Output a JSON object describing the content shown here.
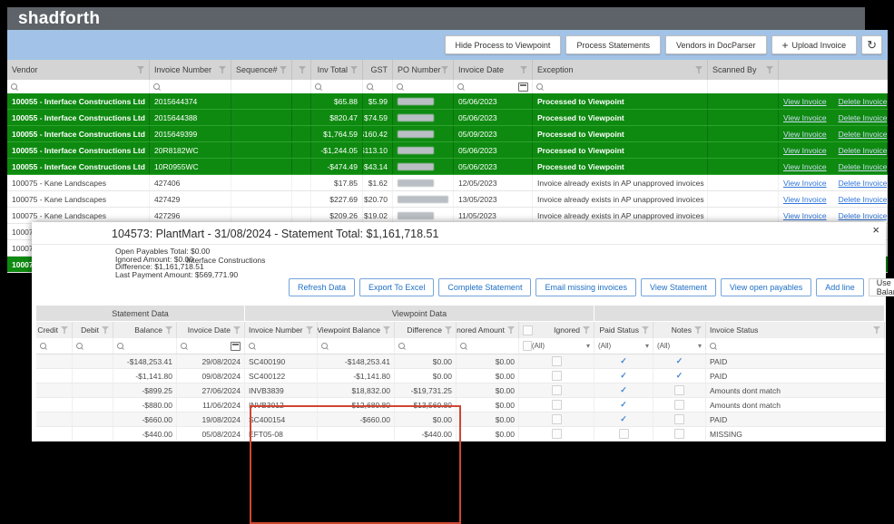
{
  "app": {
    "logo_text": "shadforth",
    "toolbar_buttons": [
      "Hide Process to Viewpoint",
      "Process Statements",
      "Vendors in DocParser"
    ],
    "upload_button": "Upload Invoice",
    "refresh_icon": "refresh-icon",
    "colors": {
      "header_bar": "#5d6368",
      "toolbar_blue": "#a2c3e7",
      "processed_green": "#0e8a10",
      "link_blue": "#2f74d9",
      "highlight_red": "#cf4632"
    }
  },
  "invoice_grid": {
    "columns": [
      {
        "label": "Vendor",
        "funnel": true,
        "filter": "search"
      },
      {
        "label": "Invoice Number",
        "funnel": true,
        "filter": "search"
      },
      {
        "label": "Sequence#",
        "funnel": true,
        "filter": "none"
      },
      {
        "label": "",
        "funnel": true,
        "filter": "none"
      },
      {
        "label": "Inv Total",
        "funnel": true,
        "align": "right",
        "filter": "search"
      },
      {
        "label": "GST",
        "funnel": false,
        "align": "right",
        "filter": "search"
      },
      {
        "label": "PO Number",
        "funnel": true,
        "filter": "search"
      },
      {
        "label": "Invoice Date",
        "funnel": true,
        "filter": "search cal"
      },
      {
        "label": "Exception",
        "funnel": true,
        "filter": "search"
      },
      {
        "label": "Scanned By",
        "funnel": true,
        "filter": "none"
      },
      {
        "label": "",
        "funnel": false,
        "filter": "none"
      }
    ],
    "action_labels": {
      "view": "View Invoice",
      "delete": "Delete Invoice"
    },
    "rows": [
      {
        "vendor": "100055 - Interface Constructions Ltd",
        "invoice_number": "2015644374",
        "sequence": "",
        "inv_total": "$65.88",
        "gst": "$5.99",
        "po_redacted": true,
        "po_blur": "sm",
        "invoice_date": "05/06/2023",
        "exception": "Processed to Viewpoint",
        "scanned_by": "",
        "highlighted": true
      },
      {
        "vendor": "100055 - Interface Constructions Ltd",
        "invoice_number": "2015644388",
        "sequence": "",
        "inv_total": "$820.47",
        "gst": "$74.59",
        "po_redacted": true,
        "po_blur": "sm",
        "invoice_date": "05/06/2023",
        "exception": "Processed to Viewpoint",
        "scanned_by": "",
        "highlighted": true
      },
      {
        "vendor": "100055 - Interface Constructions Ltd",
        "invoice_number": "2015649399",
        "sequence": "",
        "inv_total": "$1,764.59",
        "gst": "$160.42",
        "po_redacted": true,
        "po_blur": "sm",
        "invoice_date": "05/09/2023",
        "exception": "Processed to Viewpoint",
        "scanned_by": "",
        "highlighted": true
      },
      {
        "vendor": "100055 - Interface Constructions Ltd",
        "invoice_number": "20R8182WC",
        "sequence": "",
        "inv_total": "-$1,244.05",
        "gst": "-$113.10",
        "po_redacted": true,
        "po_blur": "sm",
        "invoice_date": "05/06/2023",
        "exception": "Processed to Viewpoint",
        "scanned_by": "",
        "highlighted": true
      },
      {
        "vendor": "100055 - Interface Constructions Ltd",
        "invoice_number": "10R0955WC",
        "sequence": "",
        "inv_total": "-$474.49",
        "gst": "-$43.14",
        "po_redacted": true,
        "po_blur": "sm",
        "invoice_date": "05/06/2023",
        "exception": "Processed to Viewpoint",
        "scanned_by": "",
        "highlighted": true
      },
      {
        "vendor": "100075 - Kane Landscapes",
        "invoice_number": "427406",
        "sequence": "",
        "inv_total": "$17.85",
        "gst": "$1.62",
        "po_redacted": true,
        "po_blur": "sm",
        "invoice_date": "12/05/2023",
        "exception": "Invoice already exists in AP unapproved invoices",
        "scanned_by": "",
        "highlighted": false
      },
      {
        "vendor": "100075 - Kane Landscapes",
        "invoice_number": "427429",
        "sequence": "",
        "inv_total": "$227.69",
        "gst": "$20.70",
        "po_redacted": true,
        "po_blur": "lg",
        "invoice_date": "13/05/2023",
        "exception": "Invoice already exists in AP unapproved invoices",
        "scanned_by": "",
        "highlighted": false
      },
      {
        "vendor": "100075 - Kane Landscapes",
        "invoice_number": "427296",
        "sequence": "",
        "inv_total": "$209.26",
        "gst": "$19.02",
        "po_redacted": true,
        "po_blur": "sm",
        "invoice_date": "11/05/2023",
        "exception": "Invoice already exists in AP unapproved invoices",
        "scanned_by": "",
        "highlighted": false
      }
    ],
    "partial_rows": [
      {
        "vendor": "100075 -",
        "highlighted": false
      },
      {
        "vendor": "100075 -",
        "highlighted": false
      },
      {
        "vendor": "100075 -",
        "highlighted": true
      }
    ]
  },
  "statement_panel": {
    "title": "104573: PlantMart - 31/08/2024 - Statement Total: $1,161,718.51",
    "close_glyph": "×",
    "summary_lines": [
      "Open Payables Total: $0.00",
      "Ignored Amount: $0.00",
      "Difference: $1,161,718.51",
      "Last Payment Amount: $569,771.90"
    ],
    "vendor_note": "Interface Constructions",
    "action_buttons": [
      "Refresh Data",
      "Export To Excel",
      "Complete Statement",
      "Email missing invoices",
      "View Statement",
      "View open payables",
      "Add line"
    ],
    "balance_dropdown_value": "Use Balance",
    "grid": {
      "group_headers": [
        "Statement Data",
        "Viewpoint Data",
        ""
      ],
      "filter_all_label": "(All)",
      "columns": [
        {
          "label": "Credit",
          "align": "right",
          "filter": "search"
        },
        {
          "label": "Debit",
          "align": "right",
          "filter": "search"
        },
        {
          "label": "Balance",
          "align": "right",
          "filter": "search"
        },
        {
          "label": "Invoice Date",
          "align": "right",
          "filter": "search cal"
        },
        {
          "label": "Invoice Number",
          "filter": "search"
        },
        {
          "label": "Viewpoint Balance",
          "align": "right",
          "filter": "search"
        },
        {
          "label": "Difference",
          "align": "right",
          "filter": "search"
        },
        {
          "label": "Ignored Amount",
          "align": "right",
          "filter": "search"
        },
        {
          "label": "Ignored",
          "align": "right",
          "filter": "all",
          "header_checkbox": true
        },
        {
          "label": "Paid Status",
          "align": "right",
          "filter": "all"
        },
        {
          "label": "Notes",
          "align": "right",
          "filter": "all"
        },
        {
          "label": "Invoice Status",
          "filter": "search"
        }
      ],
      "rows": [
        {
          "credit": "",
          "debit": "",
          "balance": "-$148,253.41",
          "invoice_date": "29/08/2024",
          "invoice_number": "SC400190",
          "viewpoint_balance": "-$148,253.41",
          "difference": "$0.00",
          "ignored_amount": "$0.00",
          "ignored": false,
          "paid_status": true,
          "notes": true,
          "invoice_status": "PAID"
        },
        {
          "credit": "",
          "debit": "",
          "balance": "-$1,141.80",
          "invoice_date": "09/08/2024",
          "invoice_number": "SC400122",
          "viewpoint_balance": "-$1,141.80",
          "difference": "$0.00",
          "ignored_amount": "$0.00",
          "ignored": false,
          "paid_status": true,
          "notes": true,
          "invoice_status": "PAID"
        },
        {
          "credit": "",
          "debit": "",
          "balance": "-$899.25",
          "invoice_date": "27/06/2024",
          "invoice_number": "INVB3839",
          "viewpoint_balance": "$18,832.00",
          "difference": "-$19,731.25",
          "ignored_amount": "$0.00",
          "ignored": false,
          "paid_status": true,
          "notes": false,
          "invoice_status": "Amounts dont match"
        },
        {
          "credit": "",
          "debit": "",
          "balance": "-$880.00",
          "invoice_date": "11/06/2024",
          "invoice_number": "INVB3012",
          "viewpoint_balance": "$12,680.80",
          "difference": "-$13,560.80",
          "ignored_amount": "$0.00",
          "ignored": false,
          "paid_status": true,
          "notes": false,
          "invoice_status": "Amounts dont match"
        },
        {
          "credit": "",
          "debit": "",
          "balance": "-$660.00",
          "invoice_date": "19/08/2024",
          "invoice_number": "SC400154",
          "viewpoint_balance": "-$660.00",
          "difference": "$0.00",
          "ignored_amount": "$0.00",
          "ignored": false,
          "paid_status": true,
          "notes": false,
          "invoice_status": "PAID"
        },
        {
          "credit": "",
          "debit": "",
          "balance": "-$440.00",
          "invoice_date": "05/08/2024",
          "invoice_number": "EFT05-08",
          "viewpoint_balance": "",
          "difference": "-$440.00",
          "ignored_amount": "$0.00",
          "ignored": false,
          "paid_status": false,
          "notes": false,
          "invoice_status": "MISSING"
        }
      ]
    }
  }
}
